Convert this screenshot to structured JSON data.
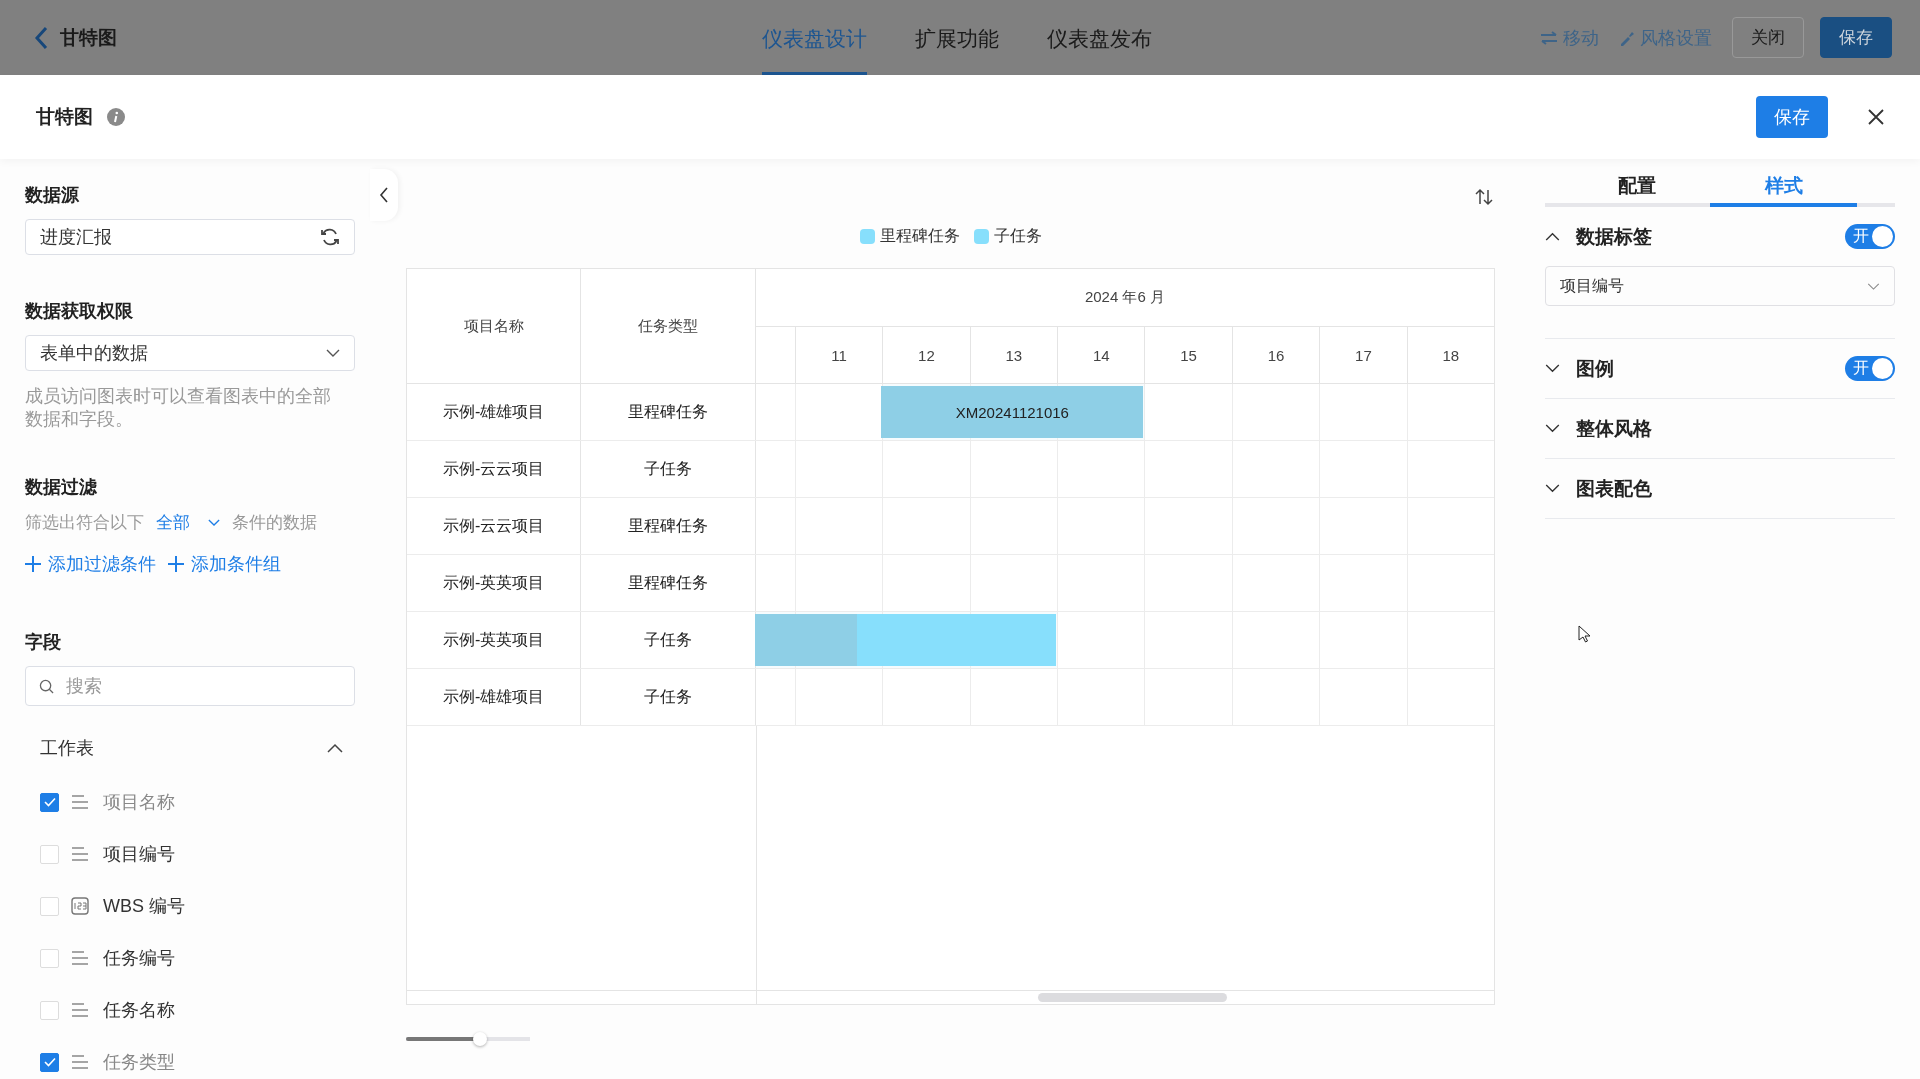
{
  "topbar": {
    "title": "甘特图",
    "tabs": [
      {
        "label": "仪表盘设计",
        "selected": true
      },
      {
        "label": "扩展功能",
        "selected": false
      },
      {
        "label": "仪表盘发布",
        "selected": false
      }
    ],
    "actions": [
      {
        "label": "移动",
        "kind": "move"
      },
      {
        "label": "风格设置",
        "kind": "style"
      }
    ],
    "buttons": [
      {
        "label": "关闭",
        "kind": "default"
      },
      {
        "label": "保存",
        "kind": "primary"
      }
    ]
  },
  "dialog": {
    "title": "甘特图",
    "save": "保存"
  },
  "left": {
    "datasource": {
      "heading": "数据源",
      "value": "进度汇报"
    },
    "permission": {
      "heading": "数据获取权限",
      "value": "表单中的数据",
      "help": "成员访问图表时可以查看图表中的全部数据和字段。"
    },
    "filter": {
      "heading": "数据过滤",
      "prefix": "筛选出符合以下",
      "mode": "全部",
      "suffix": "条件的数据",
      "links": [
        "添加过滤条件",
        "添加条件组"
      ]
    },
    "fields": {
      "heading": "字段",
      "placeholder": "搜索",
      "group": {
        "label": "工作表",
        "expanded": true
      },
      "items": [
        {
          "label": "项目名称",
          "kind": "text",
          "checked": true
        },
        {
          "label": "项目编号",
          "kind": "text",
          "checked": false
        },
        {
          "label": "WBS 编号",
          "kind": "number",
          "checked": false
        },
        {
          "label": "任务编号",
          "kind": "text",
          "checked": false
        },
        {
          "label": "任务名称",
          "kind": "text",
          "checked": false
        },
        {
          "label": "任务类型",
          "kind": "text",
          "checked": true
        }
      ]
    }
  },
  "chart": {
    "legend": [
      {
        "label": "里程碑任务",
        "color": "#87dffc"
      },
      {
        "label": "子任务",
        "color": "#87dffc"
      }
    ],
    "columns": [
      "项目名称",
      "任务类型"
    ],
    "month": "2024 年6 月",
    "days": [
      "11",
      "12",
      "13",
      "14",
      "15",
      "16",
      "17",
      "18"
    ],
    "rows": [
      {
        "project": "示例-雄雄项目",
        "type": "里程碑任务",
        "bar": {
          "cover": [
            false,
            false,
            true,
            true,
            true,
            false,
            false,
            false,
            false
          ],
          "level": 1,
          "label": "XM20241121016"
        }
      },
      {
        "project": "示例-云云项目",
        "type": "子任务"
      },
      {
        "project": "示例-云云项目",
        "type": "里程碑任务"
      },
      {
        "project": "示例-英英项目",
        "type": "里程碑任务"
      },
      {
        "project": "示例-英英项目",
        "type": "子任务",
        "bar": {
          "cover": [
            true,
            true,
            true,
            true,
            false,
            false,
            false,
            false,
            false
          ],
          "level": 0.34
        }
      },
      {
        "project": "示例-雄雄项目",
        "type": "子任务"
      }
    ],
    "zoom": {
      "level": 0.6
    }
  },
  "right": {
    "tabs": [
      {
        "label": "配置",
        "selected": false
      },
      {
        "label": "样式",
        "selected": true
      }
    ],
    "sections": [
      {
        "title": "数据标签",
        "expanded": true,
        "toggle": {
          "on": true,
          "label": "开"
        },
        "select": "项目编号"
      },
      {
        "title": "图例",
        "expanded": false,
        "toggle": {
          "on": true,
          "label": "开"
        }
      },
      {
        "title": "整体风格",
        "expanded": false
      },
      {
        "title": "图表配色",
        "expanded": false
      }
    ]
  }
}
